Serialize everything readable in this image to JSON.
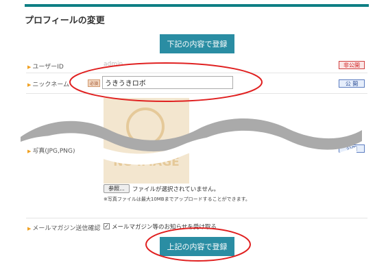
{
  "page": {
    "title": "プロフィールの変更"
  },
  "buttons": {
    "submit_top": "下記の内容で登録",
    "submit_bottom": "上記の内容で登録"
  },
  "rows": {
    "user_id": {
      "label": "ユーザーID",
      "value": "admin",
      "visibility": "非公開"
    },
    "nickname": {
      "label": "ニックネーム",
      "required": "必須",
      "value": "うきうきロボ",
      "visibility": "公 開"
    },
    "photo": {
      "label": "写真(JPG,PNG)",
      "visibility": "公開",
      "placeholder_text": "NO IMAGE"
    },
    "newsletter": {
      "label": "メールマガジン送信確認",
      "checkbox_label": "メールマガジン等のお知らせを受け取る",
      "checked": true
    }
  },
  "file": {
    "browse_label": "参照...",
    "status": "ファイルが選択されていません。",
    "note": "※写真ファイルは最大10MBまでアップロードすることができます。"
  },
  "colors": {
    "accent": "#0e7f84",
    "button": "#2a8da3",
    "highlight_ellipse": "#e02020",
    "wave": "#aaaaaa"
  }
}
